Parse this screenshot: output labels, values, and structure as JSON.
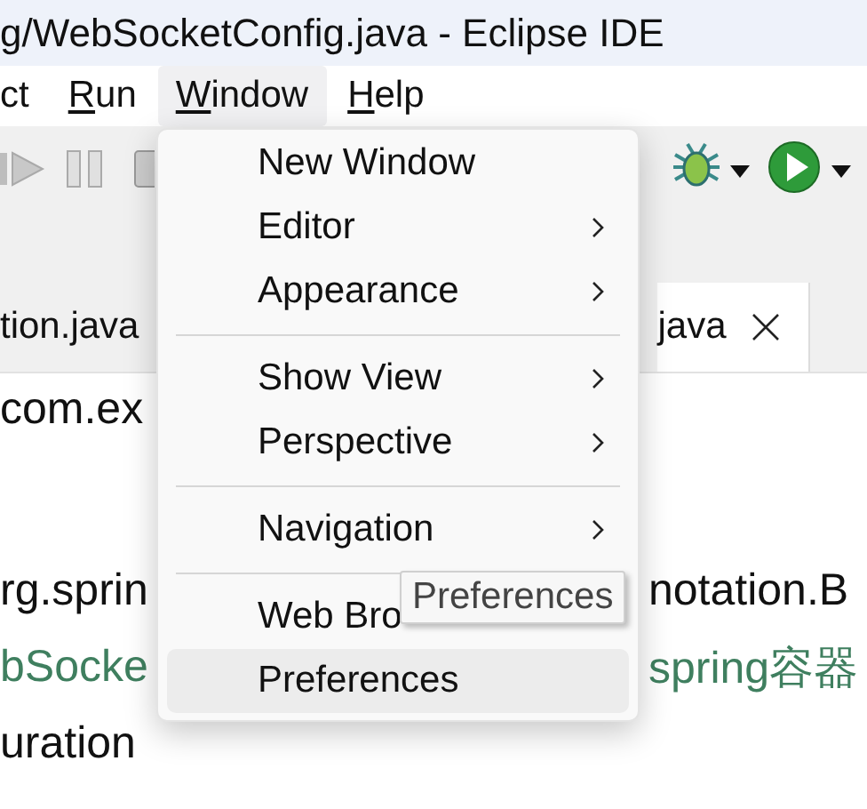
{
  "window": {
    "title": "g/WebSocketConfig.java - Eclipse IDE"
  },
  "menu_bar": [
    {
      "label": "ct",
      "selected": false,
      "mnemonic": false
    },
    {
      "label": "Run",
      "selected": false,
      "mnemonic": true
    },
    {
      "label": "Window",
      "selected": true,
      "mnemonic": true
    },
    {
      "label": "Help",
      "selected": false,
      "mnemonic": true
    }
  ],
  "tabs": [
    {
      "label": "tion.java",
      "selected": false,
      "closable": false
    },
    {
      "label": "java",
      "selected": true,
      "closable": true
    }
  ],
  "editor_lines": [
    {
      "kind": "code",
      "left": "com.ex"
    },
    {
      "kind": "blank"
    },
    {
      "kind": "code",
      "left": "rg.sprin",
      "right": "notation.B"
    },
    {
      "kind": "comment",
      "left": "bSocke",
      "right": "spring容器"
    },
    {
      "kind": "code",
      "left": "uration"
    }
  ],
  "window_menu": {
    "items": [
      {
        "kind": "item",
        "label": "New Window",
        "submenu": false,
        "selected": false
      },
      {
        "kind": "item",
        "label": "Editor",
        "submenu": true,
        "selected": false
      },
      {
        "kind": "item",
        "label": "Appearance",
        "submenu": true,
        "selected": false
      },
      {
        "kind": "separator"
      },
      {
        "kind": "item",
        "label": "Show View",
        "submenu": true,
        "selected": false
      },
      {
        "kind": "item",
        "label": "Perspective",
        "submenu": true,
        "selected": false
      },
      {
        "kind": "separator"
      },
      {
        "kind": "item",
        "label": "Navigation",
        "submenu": true,
        "selected": false
      },
      {
        "kind": "separator"
      },
      {
        "kind": "item",
        "label": "Web Bro",
        "submenu": false,
        "selected": false
      },
      {
        "kind": "item",
        "label": "Preferences",
        "submenu": false,
        "selected": true
      }
    ]
  },
  "tooltip": {
    "text": "Preferences"
  }
}
